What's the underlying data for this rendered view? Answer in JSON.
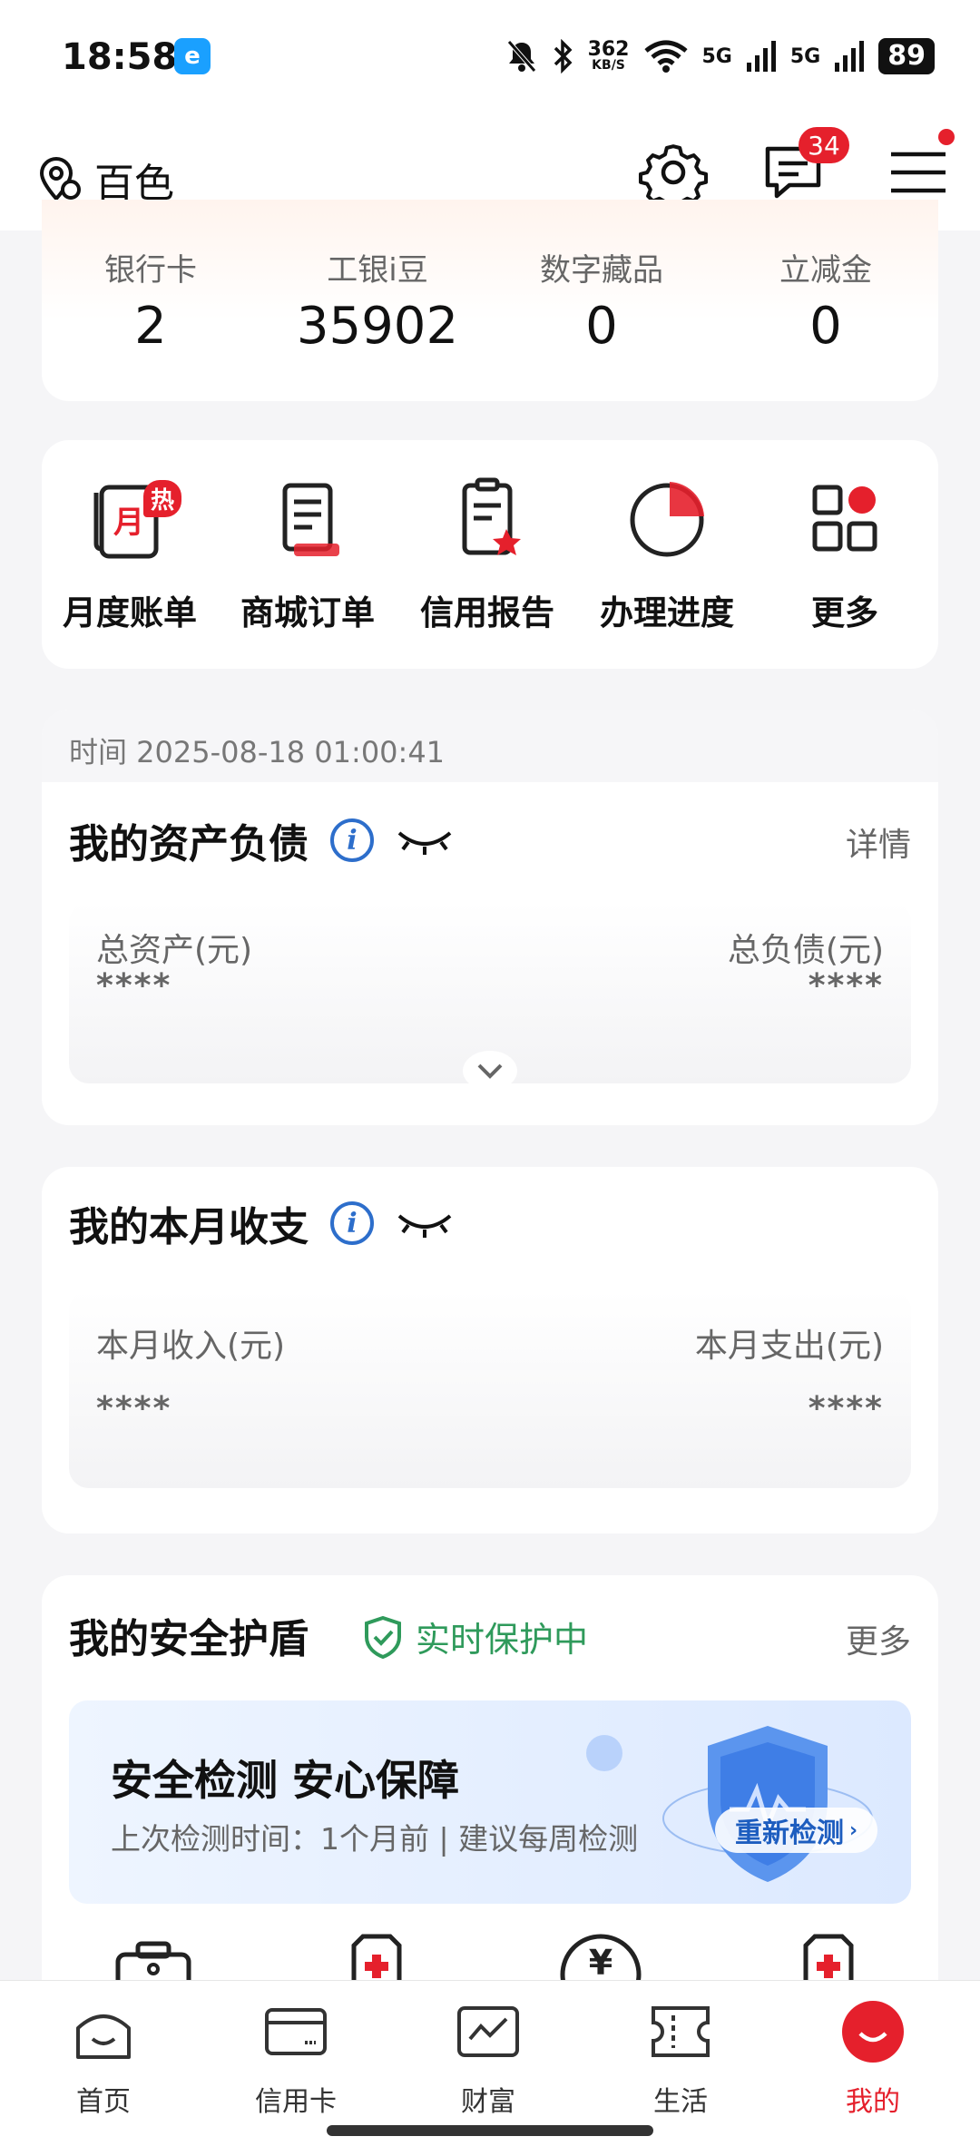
{
  "status_bar": {
    "time": "18:58",
    "app_badge": "e",
    "net_speed_value": "362",
    "net_speed_unit": "KB/S",
    "signal1": "5G",
    "signal2": "5G",
    "battery": "89"
  },
  "header": {
    "location": "百色",
    "message_count": "34",
    "icons": [
      "location-pin-icon",
      "gear-icon",
      "message-icon",
      "menu-icon"
    ]
  },
  "stats": [
    {
      "label": "银行卡",
      "value": "2"
    },
    {
      "label": "工银i豆",
      "value": "35902"
    },
    {
      "label": "数字藏品",
      "value": "0"
    },
    {
      "label": "立减金",
      "value": "0"
    }
  ],
  "quick_actions": {
    "hot_badge": "热",
    "items": [
      {
        "label": "月度账单",
        "icon": "monthly-bill-icon"
      },
      {
        "label": "商城订单",
        "icon": "mall-order-icon"
      },
      {
        "label": "信用报告",
        "icon": "credit-report-icon"
      },
      {
        "label": "办理进度",
        "icon": "progress-pie-icon"
      },
      {
        "label": "更多",
        "icon": "more-grid-icon"
      }
    ],
    "month_glyph": "月"
  },
  "assets": {
    "time_text": "时间 2025-08-18 01:00:41",
    "title": "我的资产负债",
    "detail": "详情",
    "total_assets_label": "总资产(元)",
    "total_assets_value": "****",
    "total_liabilities_label": "总负债(元)",
    "total_liabilities_value": "****"
  },
  "income": {
    "title": "我的本月收支",
    "income_label": "本月收入(元)",
    "income_value": "****",
    "expense_label": "本月支出(元)",
    "expense_value": "****"
  },
  "security": {
    "title": "我的安全护盾",
    "status": "实时保护中",
    "more": "更多",
    "banner_title": "安全检测 安心保障",
    "banner_sub": "上次检测时间：1个月前 | 建议每周检测",
    "recheck": "重新检测",
    "yen_glyph": "¥"
  },
  "tabs": [
    {
      "label": "首页",
      "icon": "home-icon"
    },
    {
      "label": "信用卡",
      "icon": "credit-card-icon"
    },
    {
      "label": "财富",
      "icon": "wealth-chart-icon"
    },
    {
      "label": "生活",
      "icon": "ticket-icon"
    },
    {
      "label": "我的",
      "icon": "profile-icon"
    }
  ],
  "colors": {
    "brand_red": "#e5202c",
    "info_blue": "#2d6ecb",
    "secure_green": "#2f9a5b"
  }
}
